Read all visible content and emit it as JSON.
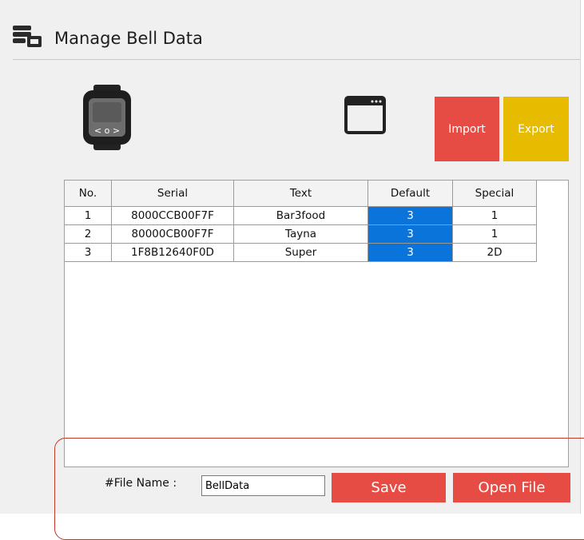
{
  "header": {
    "title": "Manage Bell Data",
    "icon": "database-icon"
  },
  "actions": {
    "import_label": "Import",
    "export_label": "Export"
  },
  "colors": {
    "accent_red": "#e74c44",
    "accent_yellow": "#e6bb00",
    "selection_blue": "#0a74da"
  },
  "table": {
    "columns": [
      "No.",
      "Serial",
      "Text",
      "Default",
      "Special"
    ],
    "rows": [
      [
        "1",
        "8000CCB00F7F",
        "Bar3food",
        "3",
        "1"
      ],
      [
        "2",
        "80000CB00F7F",
        "Tayna",
        "3",
        "1"
      ],
      [
        "3",
        "1F8B12640F0D",
        "Super",
        "3",
        "2D"
      ]
    ]
  },
  "footer": {
    "file_name_label": "#File Name :",
    "file_name_value": "BellData",
    "save_label": "Save",
    "open_label": "Open File"
  }
}
